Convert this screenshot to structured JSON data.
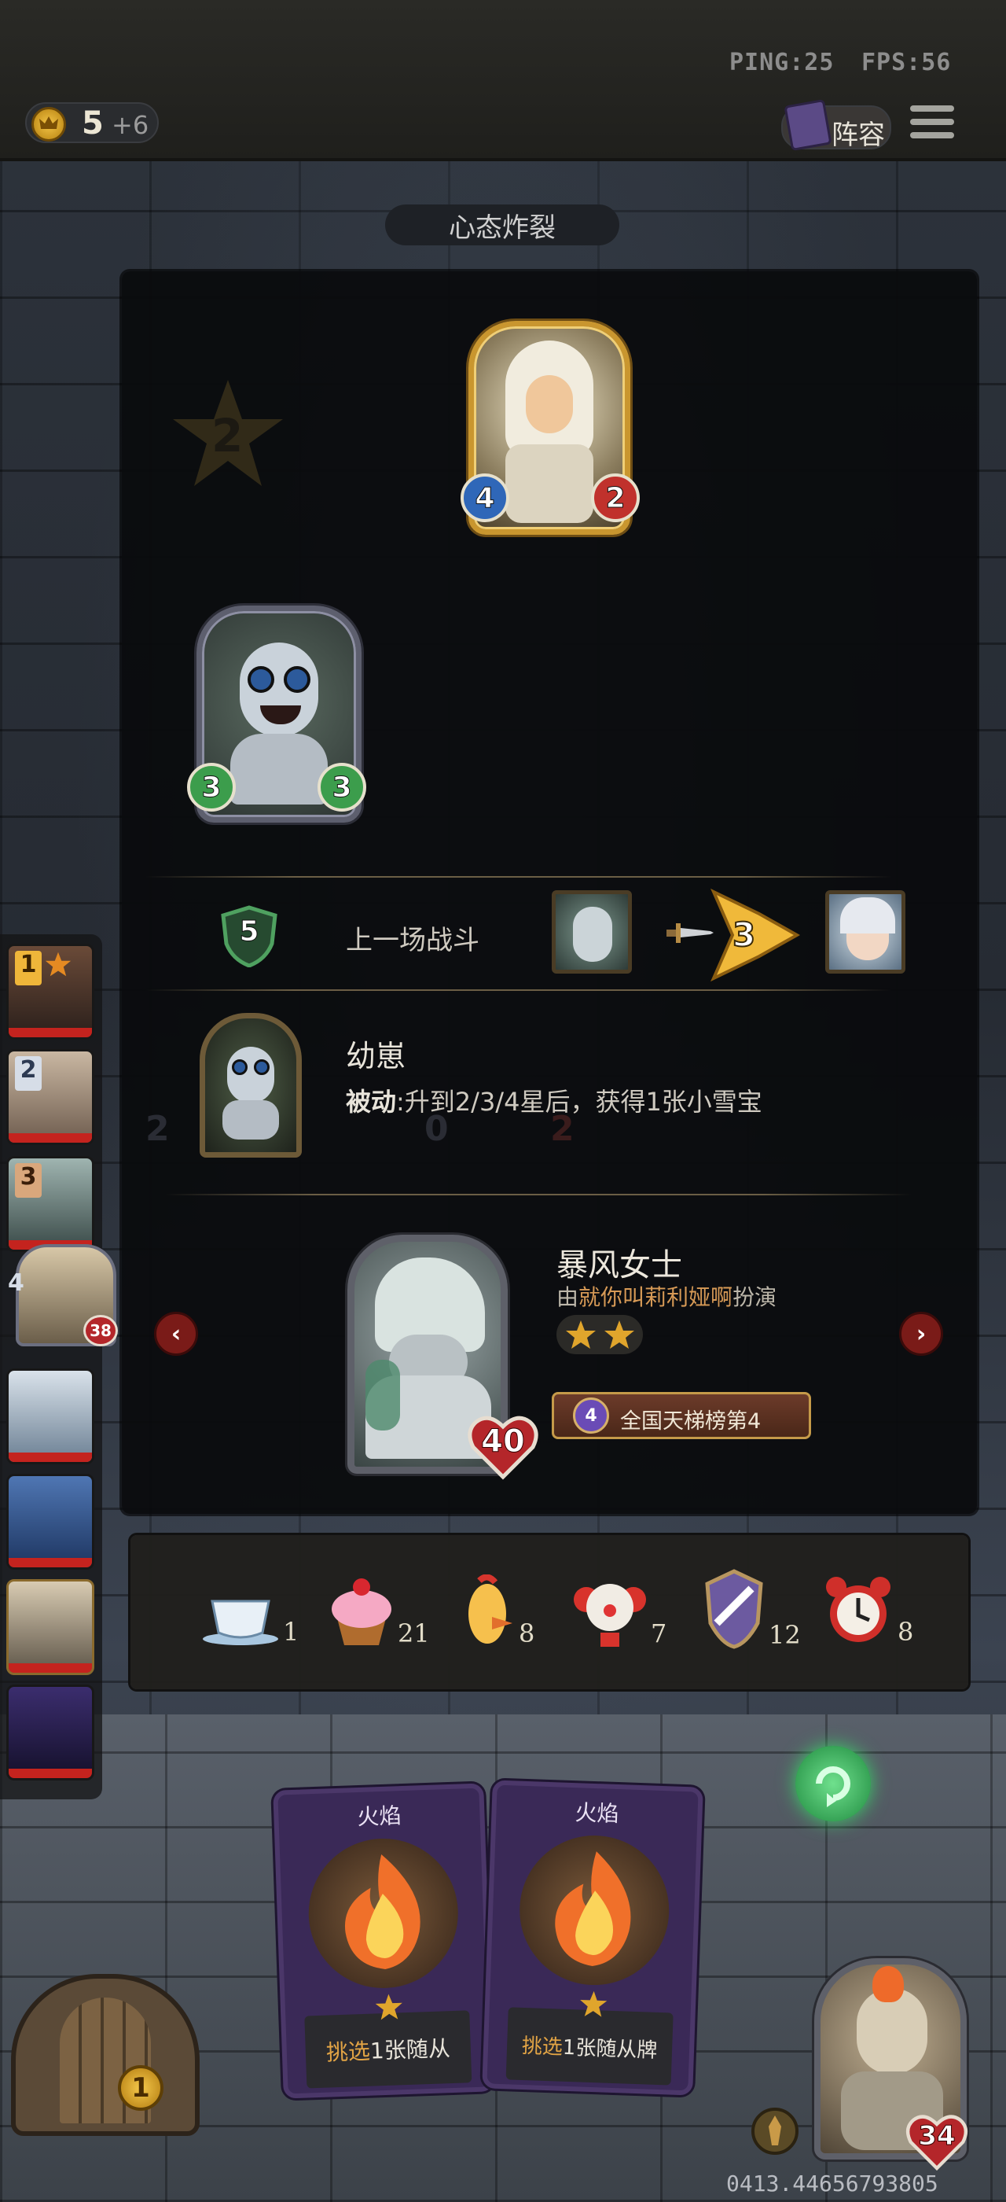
{
  "top": {
    "ping": "PING:25",
    "fps": "FPS:56",
    "gold": "5",
    "gold_income": "+6",
    "lineup_button": "阵容",
    "menu_icon": "menu-icon"
  },
  "panel": {
    "title": "心态炸裂",
    "watermark_star": "2",
    "top_minion": {
      "attack": "4",
      "health": "2"
    },
    "left_minion": {
      "attack": "3",
      "health": "3"
    },
    "last_battle": {
      "label": "上一场战斗",
      "shield_value": "5",
      "damage": "3"
    },
    "hero_power": {
      "name": "幼崽",
      "desc_prefix": "被动",
      "desc_rest": ":升到2/3/4星后，获得1张小雪宝",
      "ghost_values": [
        "2",
        "0",
        "2"
      ]
    },
    "opponent": {
      "hero_name": "暴风女士",
      "played_by_prefix": "由",
      "player_name": "就你叫莉利娅啊",
      "played_by_suffix": "扮演",
      "stars": 2,
      "health": "40",
      "rank_tier": "4",
      "rank_text": "全国天梯榜第4"
    }
  },
  "items": [
    {
      "icon": "teacup-icon",
      "count": "1"
    },
    {
      "icon": "cupcake-icon",
      "count": "21"
    },
    {
      "icon": "chicken-icon",
      "count": "8"
    },
    {
      "icon": "clown-icon",
      "count": "7"
    },
    {
      "icon": "shield-crest-icon",
      "count": "12"
    },
    {
      "icon": "alarm-clock-icon",
      "count": "8"
    }
  ],
  "sidebar": [
    {
      "rank": "1"
    },
    {
      "rank": "2"
    },
    {
      "rank": "3"
    },
    {
      "rank": "4",
      "health": "38"
    },
    {
      "rank": ""
    },
    {
      "rank": ""
    },
    {
      "rank": ""
    },
    {
      "rank": ""
    }
  ],
  "cards": [
    {
      "title": "火焰",
      "desc_highlight": "挑选",
      "desc_rest": "1张随从"
    },
    {
      "title": "火焰",
      "desc_highlight": "挑选",
      "desc_rest": "1张随从牌"
    }
  ],
  "bottom": {
    "tavern_tier": "1",
    "hero_health": "34",
    "footer_code": "0413.44656793805"
  },
  "colors": {
    "gold": "#c9962f",
    "panel_bg": "#0a0b0d",
    "card_purple": "#3a2957",
    "accent_orange": "#d79a56",
    "health_red": "#c0312c"
  }
}
